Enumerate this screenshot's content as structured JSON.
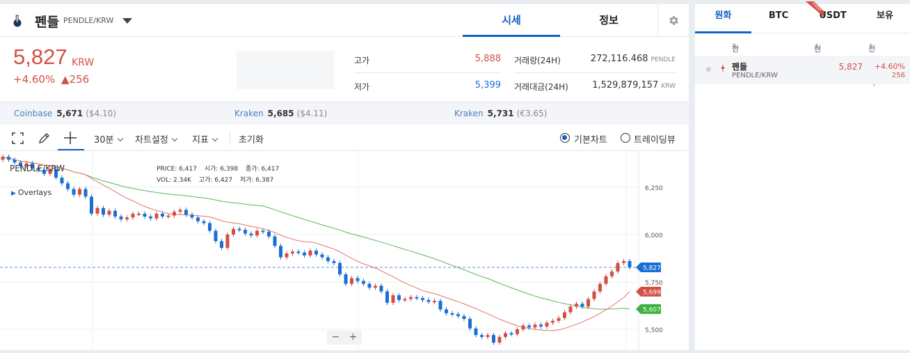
{
  "header": {
    "coin_name": "펜들",
    "pair": "PENDLE/KRW",
    "tab_quote": "시세",
    "tab_info": "정보"
  },
  "price": {
    "current": "5,827",
    "unit": "KRW",
    "change_pct": "+4.60%",
    "change_abs": "▲256"
  },
  "stats": {
    "high_label": "고가",
    "high_value": "5,888",
    "low_label": "저가",
    "low_value": "5,399",
    "volume_label": "거래량(24H)",
    "volume_value": "272,116.468",
    "volume_unit": "PENDLE",
    "amount_label": "거래대금(24H)",
    "amount_value": "1,529,879,157",
    "amount_unit": "KRW"
  },
  "exchanges": [
    {
      "name": "Coinbase",
      "price": "5,671",
      "usd": "($4.10)"
    },
    {
      "name": "Kraken",
      "price": "5,685",
      "usd": "($4.11)"
    },
    {
      "name": "Kraken",
      "price": "5,731",
      "usd": "(€3.65)"
    }
  ],
  "toolbar": {
    "interval": "30분",
    "chart_settings": "차트설정",
    "indicators": "지표",
    "reset": "초기화",
    "basic_chart": "기본차트",
    "tradingview": "트레이딩뷰"
  },
  "chart": {
    "symbol": "PENDLE/KRW",
    "overlays": "Overlays",
    "ohlc": {
      "price_label": "PRICE:",
      "price": "6,417",
      "open_label": "시가:",
      "open": "6,398",
      "close_label": "종가:",
      "close": "6,417",
      "vol_label": "VOL:",
      "vol": "2.34K",
      "high_label": "고가:",
      "high": "6,427",
      "low_label": "저가:",
      "low": "6,387"
    },
    "zoom_out": "−",
    "zoom_in": "+"
  },
  "chart_data": {
    "type": "candlestick",
    "y_ticks": [
      6250,
      6000,
      5750,
      5500
    ],
    "y_tick_labels": [
      "6,250",
      "6,000",
      "5,750",
      "5,500"
    ],
    "ylim": [
      5390,
      6440
    ],
    "current_price": 5827,
    "current_label": "5,827",
    "ma_short_last": 5699,
    "ma_short_label": "5,699",
    "ma_long_last": 5607,
    "ma_long_label": "5,607",
    "colors": {
      "up": "#d24f45",
      "down": "#1a6fd6",
      "ma_short": "#e07465",
      "ma_long": "#5ab55a"
    },
    "closes": [
      6410,
      6395,
      6380,
      6360,
      6375,
      6350,
      6340,
      6320,
      6345,
      6300,
      6270,
      6240,
      6210,
      6240,
      6200,
      6110,
      6140,
      6105,
      6125,
      6095,
      6080,
      6090,
      6110,
      6110,
      6095,
      6085,
      6110,
      6095,
      6100,
      6120,
      6130,
      6105,
      6090,
      6070,
      6060,
      6020,
      5965,
      5930,
      6000,
      6030,
      6025,
      6005,
      5995,
      6020,
      6015,
      5990,
      5940,
      5880,
      5900,
      5910,
      5905,
      5890,
      5915,
      5895,
      5880,
      5860,
      5850,
      5790,
      5740,
      5770,
      5755,
      5740,
      5720,
      5730,
      5700,
      5640,
      5680,
      5655,
      5660,
      5670,
      5665,
      5655,
      5645,
      5650,
      5605,
      5585,
      5580,
      5570,
      5555,
      5505,
      5470,
      5460,
      5470,
      5430,
      5460,
      5480,
      5475,
      5500,
      5520,
      5510,
      5525,
      5515,
      5535,
      5545,
      5560,
      5590,
      5620,
      5635,
      5620,
      5660,
      5700,
      5740,
      5780,
      5805,
      5850,
      5860,
      5827
    ],
    "opens": [
      6395,
      6410,
      6395,
      6380,
      6360,
      6375,
      6350,
      6340,
      6320,
      6345,
      6300,
      6270,
      6240,
      6210,
      6240,
      6200,
      6110,
      6140,
      6105,
      6125,
      6095,
      6080,
      6090,
      6110,
      6110,
      6095,
      6085,
      6110,
      6095,
      6100,
      6120,
      6130,
      6105,
      6090,
      6070,
      6060,
      6020,
      5965,
      5930,
      6000,
      6030,
      6025,
      6005,
      5995,
      6020,
      6015,
      5990,
      5940,
      5880,
      5900,
      5910,
      5905,
      5890,
      5915,
      5895,
      5880,
      5860,
      5850,
      5790,
      5740,
      5770,
      5755,
      5740,
      5720,
      5730,
      5700,
      5640,
      5680,
      5655,
      5660,
      5670,
      5665,
      5655,
      5645,
      5650,
      5605,
      5585,
      5580,
      5570,
      5555,
      5505,
      5470,
      5460,
      5470,
      5430,
      5460,
      5480,
      5475,
      5500,
      5520,
      5510,
      5525,
      5515,
      5535,
      5545,
      5560,
      5590,
      5620,
      5635,
      5620,
      5660,
      5700,
      5740,
      5780,
      5805,
      5850,
      5860
    ]
  },
  "sidebar": {
    "tabs": [
      "원화",
      "BTC",
      "USDT",
      "보유"
    ],
    "event_badge": "EVENT",
    "col_name": "한글명",
    "col_price": "현재가",
    "col_change": "전일대비",
    "row": {
      "name": "펜들",
      "pair": "PENDLE/KRW",
      "price": "5,827",
      "change_pct": "+4.60%",
      "change_abs": "256"
    }
  }
}
